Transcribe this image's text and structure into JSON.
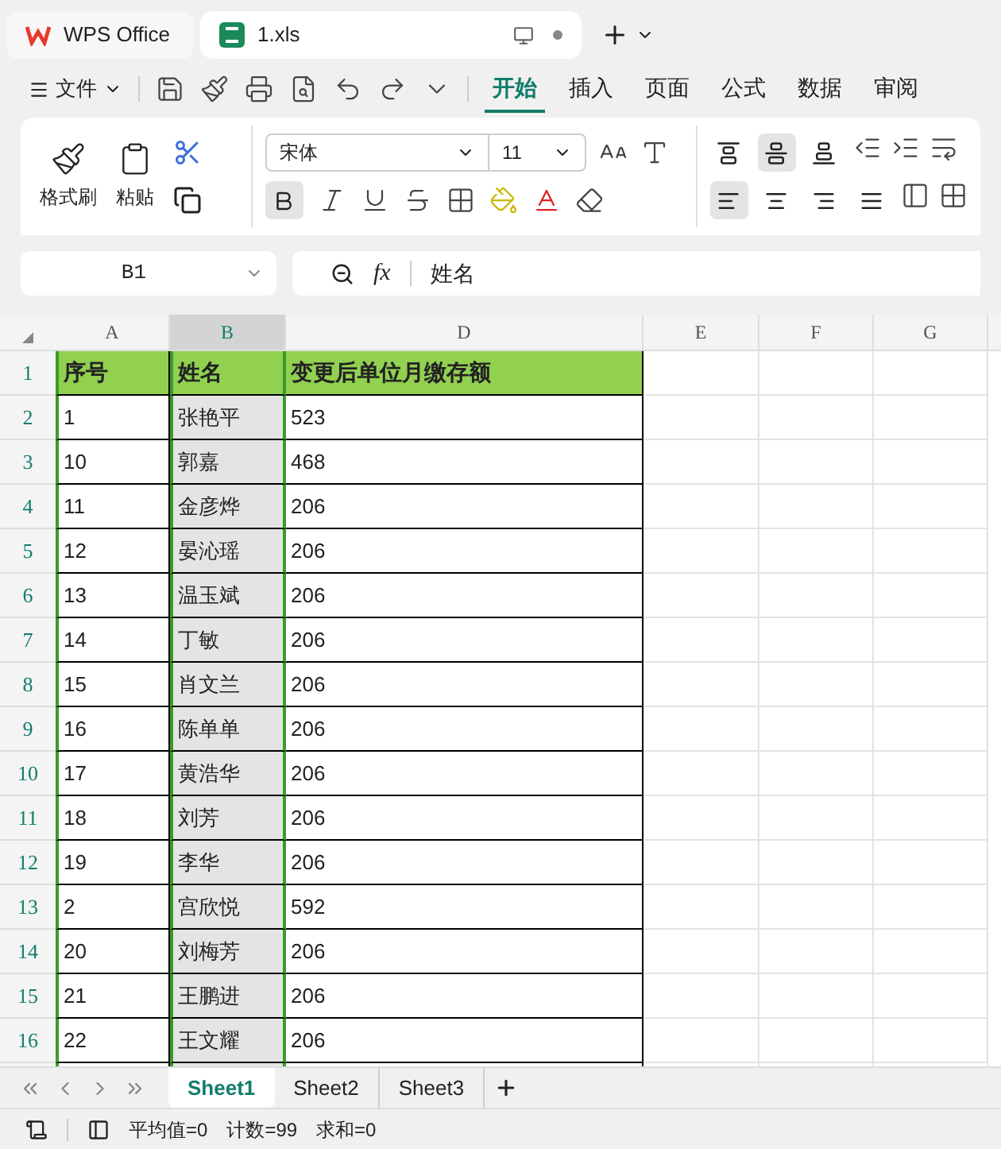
{
  "tabs": [
    {
      "label": "WPS Office",
      "kind": "home",
      "selected": false
    },
    {
      "label": "1.xls",
      "kind": "file",
      "selected": true
    }
  ],
  "menu": {
    "file": "文件",
    "tabs": [
      {
        "label": "开始",
        "selected": true
      },
      {
        "label": "插入",
        "selected": false
      },
      {
        "label": "页面",
        "selected": false
      },
      {
        "label": "公式",
        "selected": false
      },
      {
        "label": "数据",
        "selected": false
      },
      {
        "label": "审阅",
        "selected": false
      }
    ]
  },
  "ribbon": {
    "format_painter": "格式刷",
    "paste": "粘贴",
    "font_name": "宋体",
    "font_size": "11",
    "bold": true,
    "vertical_align": [
      {
        "kind": "top",
        "selected": false
      },
      {
        "kind": "middle",
        "selected": true
      },
      {
        "kind": "bottom",
        "selected": false
      }
    ],
    "horizontal_align": [
      {
        "kind": "left",
        "selected": true
      },
      {
        "kind": "center",
        "selected": false
      },
      {
        "kind": "right",
        "selected": false
      },
      {
        "kind": "justify",
        "selected": false
      }
    ]
  },
  "formula_bar": {
    "cell": "B1",
    "fx_label": "fx",
    "content": "姓名"
  },
  "columns": [
    {
      "label": "A",
      "selected": false
    },
    {
      "label": "B",
      "selected": true
    },
    {
      "label": "D",
      "selected": false
    },
    {
      "label": "E",
      "selected": false
    },
    {
      "label": "F",
      "selected": false
    },
    {
      "label": "G",
      "selected": false
    }
  ],
  "rows": [
    {
      "number": "1",
      "cells": [
        "序号",
        "姓名",
        "变更后单位月缴存额"
      ]
    },
    {
      "number": "2",
      "cells": [
        "1",
        "张艳平",
        "523"
      ]
    },
    {
      "number": "3",
      "cells": [
        "10",
        "郭嘉",
        "468"
      ]
    },
    {
      "number": "4",
      "cells": [
        "11",
        "金彦烨",
        "206"
      ]
    },
    {
      "number": "5",
      "cells": [
        "12",
        "晏沁瑶",
        "206"
      ]
    },
    {
      "number": "6",
      "cells": [
        "13",
        "温玉斌",
        "206"
      ]
    },
    {
      "number": "7",
      "cells": [
        "14",
        "丁敏",
        "206"
      ]
    },
    {
      "number": "8",
      "cells": [
        "15",
        "肖文兰",
        "206"
      ]
    },
    {
      "number": "9",
      "cells": [
        "16",
        "陈单单",
        "206"
      ]
    },
    {
      "number": "10",
      "cells": [
        "17",
        "黄浩华",
        "206"
      ]
    },
    {
      "number": "11",
      "cells": [
        "18",
        "刘芳",
        "206"
      ]
    },
    {
      "number": "12",
      "cells": [
        "19",
        "李华",
        "206"
      ]
    },
    {
      "number": "13",
      "cells": [
        "2",
        "宫欣悦",
        "592"
      ]
    },
    {
      "number": "14",
      "cells": [
        "20",
        "刘梅芳",
        "206"
      ]
    },
    {
      "number": "15",
      "cells": [
        "21",
        "王鹏进",
        "206"
      ]
    },
    {
      "number": "16",
      "cells": [
        "22",
        "王文耀",
        "206"
      ]
    }
  ],
  "sheets": [
    {
      "label": "Sheet1",
      "selected": true
    },
    {
      "label": "Sheet2",
      "selected": false
    },
    {
      "label": "Sheet3",
      "selected": false
    }
  ],
  "status": [
    "平均值=0",
    "计数=99",
    "求和=0"
  ]
}
